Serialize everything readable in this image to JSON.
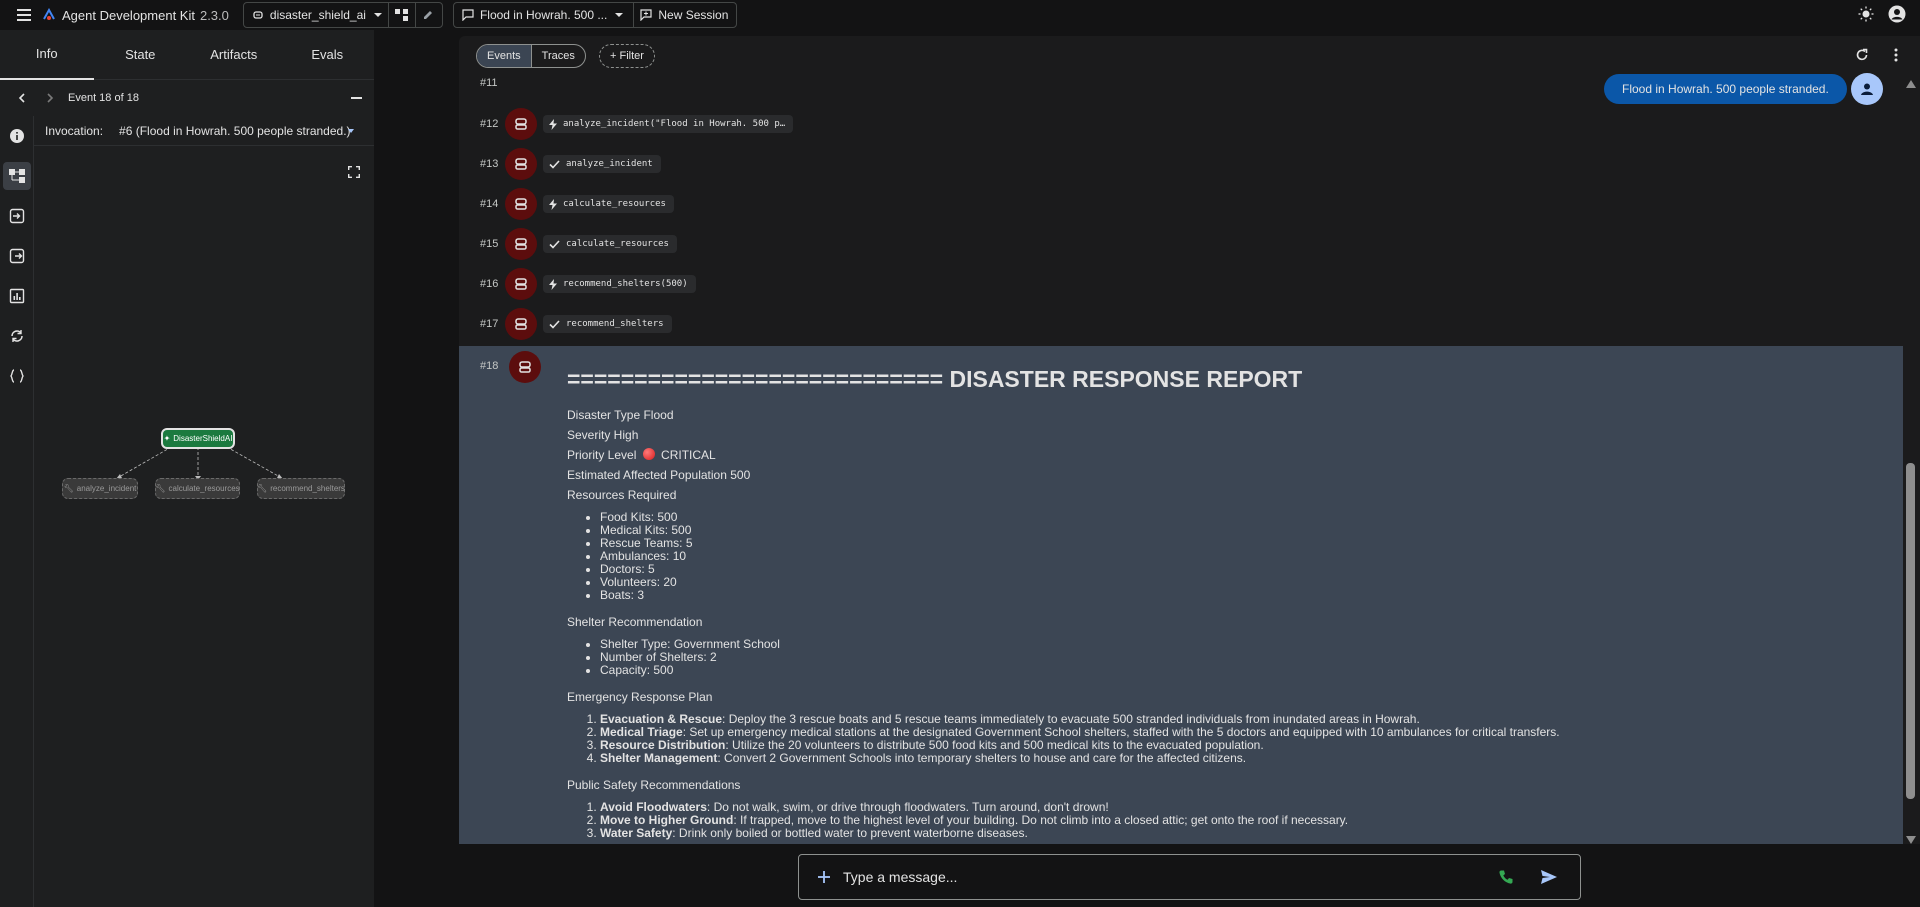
{
  "app": {
    "title": "Agent Development Kit",
    "version": "2.3.0",
    "agent_name": "disaster_shield_ai",
    "session_title": "Flood in Howrah. 500 ...",
    "new_session_label": "New Session"
  },
  "left_tabs": [
    "Info",
    "State",
    "Artifacts",
    "Evals"
  ],
  "event_nav": {
    "label": "Event 18 of 18"
  },
  "invocation": {
    "label": "Invocation:",
    "value": "#6 (Flood in Howrah. 500 people stranded.)"
  },
  "graph": {
    "root": "DisasterShieldAI",
    "tools": [
      "analyze_incident",
      "calculate_resources",
      "recommend_shelters"
    ]
  },
  "toolbar": {
    "events_label": "Events",
    "traces_label": "Traces",
    "filter_label": "Filter"
  },
  "events": [
    {
      "num": "#12",
      "kind": "call",
      "text": "analyze_incident(\"Flood in Howrah. 500 p…"
    },
    {
      "num": "#13",
      "kind": "done",
      "text": "analyze_incident"
    },
    {
      "num": "#14",
      "kind": "call",
      "text": "calculate_resources"
    },
    {
      "num": "#15",
      "kind": "done",
      "text": "calculate_resources"
    },
    {
      "num": "#16",
      "kind": "call",
      "text": "recommend_shelters(500)"
    },
    {
      "num": "#17",
      "kind": "done",
      "text": "recommend_shelters"
    }
  ],
  "event11_num": "#11",
  "user_message": "Flood in Howrah. 500 people stranded.",
  "report": {
    "num": "#18",
    "heading": "============================ DISASTER RESPONSE REPORT",
    "disaster_type": "Disaster Type Flood",
    "severity": "Severity High",
    "priority_prefix": "Priority Level",
    "priority_value": "CRITICAL",
    "population": "Estimated Affected Population 500",
    "resources_title": "Resources Required",
    "resources": [
      "Food Kits: 500",
      "Medical Kits: 500",
      "Rescue Teams: 5",
      "Ambulances: 10",
      "Doctors: 5",
      "Volunteers: 20",
      "Boats: 3"
    ],
    "shelter_title": "Shelter Recommendation",
    "shelter": [
      "Shelter Type: Government School",
      "Number of Shelters: 2",
      "Capacity: 500"
    ],
    "plan_title": "Emergency Response Plan",
    "plan": [
      {
        "b": "Evacuation & Rescue",
        "t": ": Deploy the 3 rescue boats and 5 rescue teams immediately to evacuate 500 stranded individuals from inundated areas in Howrah."
      },
      {
        "b": "Medical Triage",
        "t": ": Set up emergency medical stations at the designated Government School shelters, staffed with the 5 doctors and equipped with 10 ambulances for critical transfers."
      },
      {
        "b": "Resource Distribution",
        "t": ": Utilize the 20 volunteers to distribute 500 food kits and 500 medical kits to the evacuated population."
      },
      {
        "b": "Shelter Management",
        "t": ": Convert 2 Government Schools into temporary shelters to house and care for the affected citizens."
      }
    ],
    "safety_title": "Public Safety Recommendations",
    "safety": [
      {
        "b": "Avoid Floodwaters",
        "t": ": Do not walk, swim, or drive through floodwaters. Turn around, don't drown!"
      },
      {
        "b": "Move to Higher Ground",
        "t": ": If trapped, move to the highest level of your building. Do not climb into a closed attic; get onto the roof if necessary."
      },
      {
        "b": "Water Safety",
        "t": ": Drink only boiled or bottled water to prevent waterborne diseases."
      }
    ]
  },
  "composer": {
    "placeholder": "Type a message..."
  },
  "colors": {
    "accent_red": "#5c0d0d",
    "user_bubble": "#0b57a8",
    "report_bg": "#3c4654",
    "root_node": "#1b7a3f"
  }
}
